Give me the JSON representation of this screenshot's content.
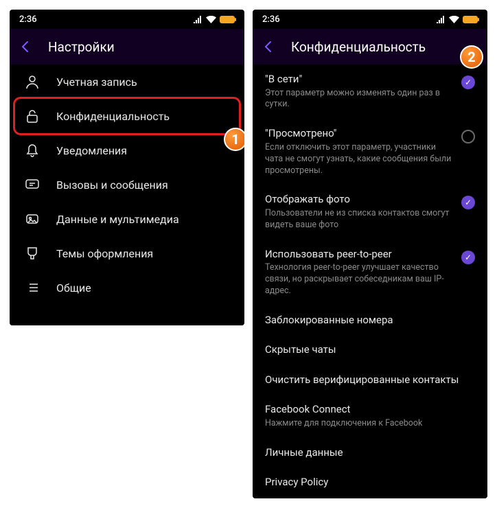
{
  "status": {
    "time": "2:36"
  },
  "left": {
    "header_title": "Настройки",
    "items": {
      "account": "Учетная запись",
      "privacy": "Конфиденциальность",
      "notifications": "Уведомления",
      "calls": "Вызовы и сообщения",
      "media": "Данные и мультимедиа",
      "themes": "Темы оформления",
      "general": "Общие"
    }
  },
  "right": {
    "header_title": "Конфиденциальность",
    "online": {
      "title": "\"В сети\"",
      "desc": "Этот параметр можно изменять один раз в сутки."
    },
    "seen": {
      "title": "\"Просмотрено\"",
      "desc": "Если отключить этот параметр, участники чата не смогут узнать, какие сообщения были просмотрены."
    },
    "photo": {
      "title": "Отображать фото",
      "desc": "Пользователи не из списка контактов смогут видеть ваше фото"
    },
    "p2p": {
      "title": "Использовать peer-to-peer",
      "desc": "Технология peer-to-peer улучшает качество связи, но раскрывает собеседникам ваш IP-адрес."
    },
    "blocked": "Заблокированные номера",
    "hidden": "Скрытые чаты",
    "clear": "Очистить верифицированные контакты",
    "fb_title": "Facebook Connect",
    "fb_desc": "Нажмите для подключения к Facebook",
    "personal": "Личные данные",
    "policy": "Privacy Policy"
  },
  "markers": {
    "one": "1",
    "two": "2"
  }
}
